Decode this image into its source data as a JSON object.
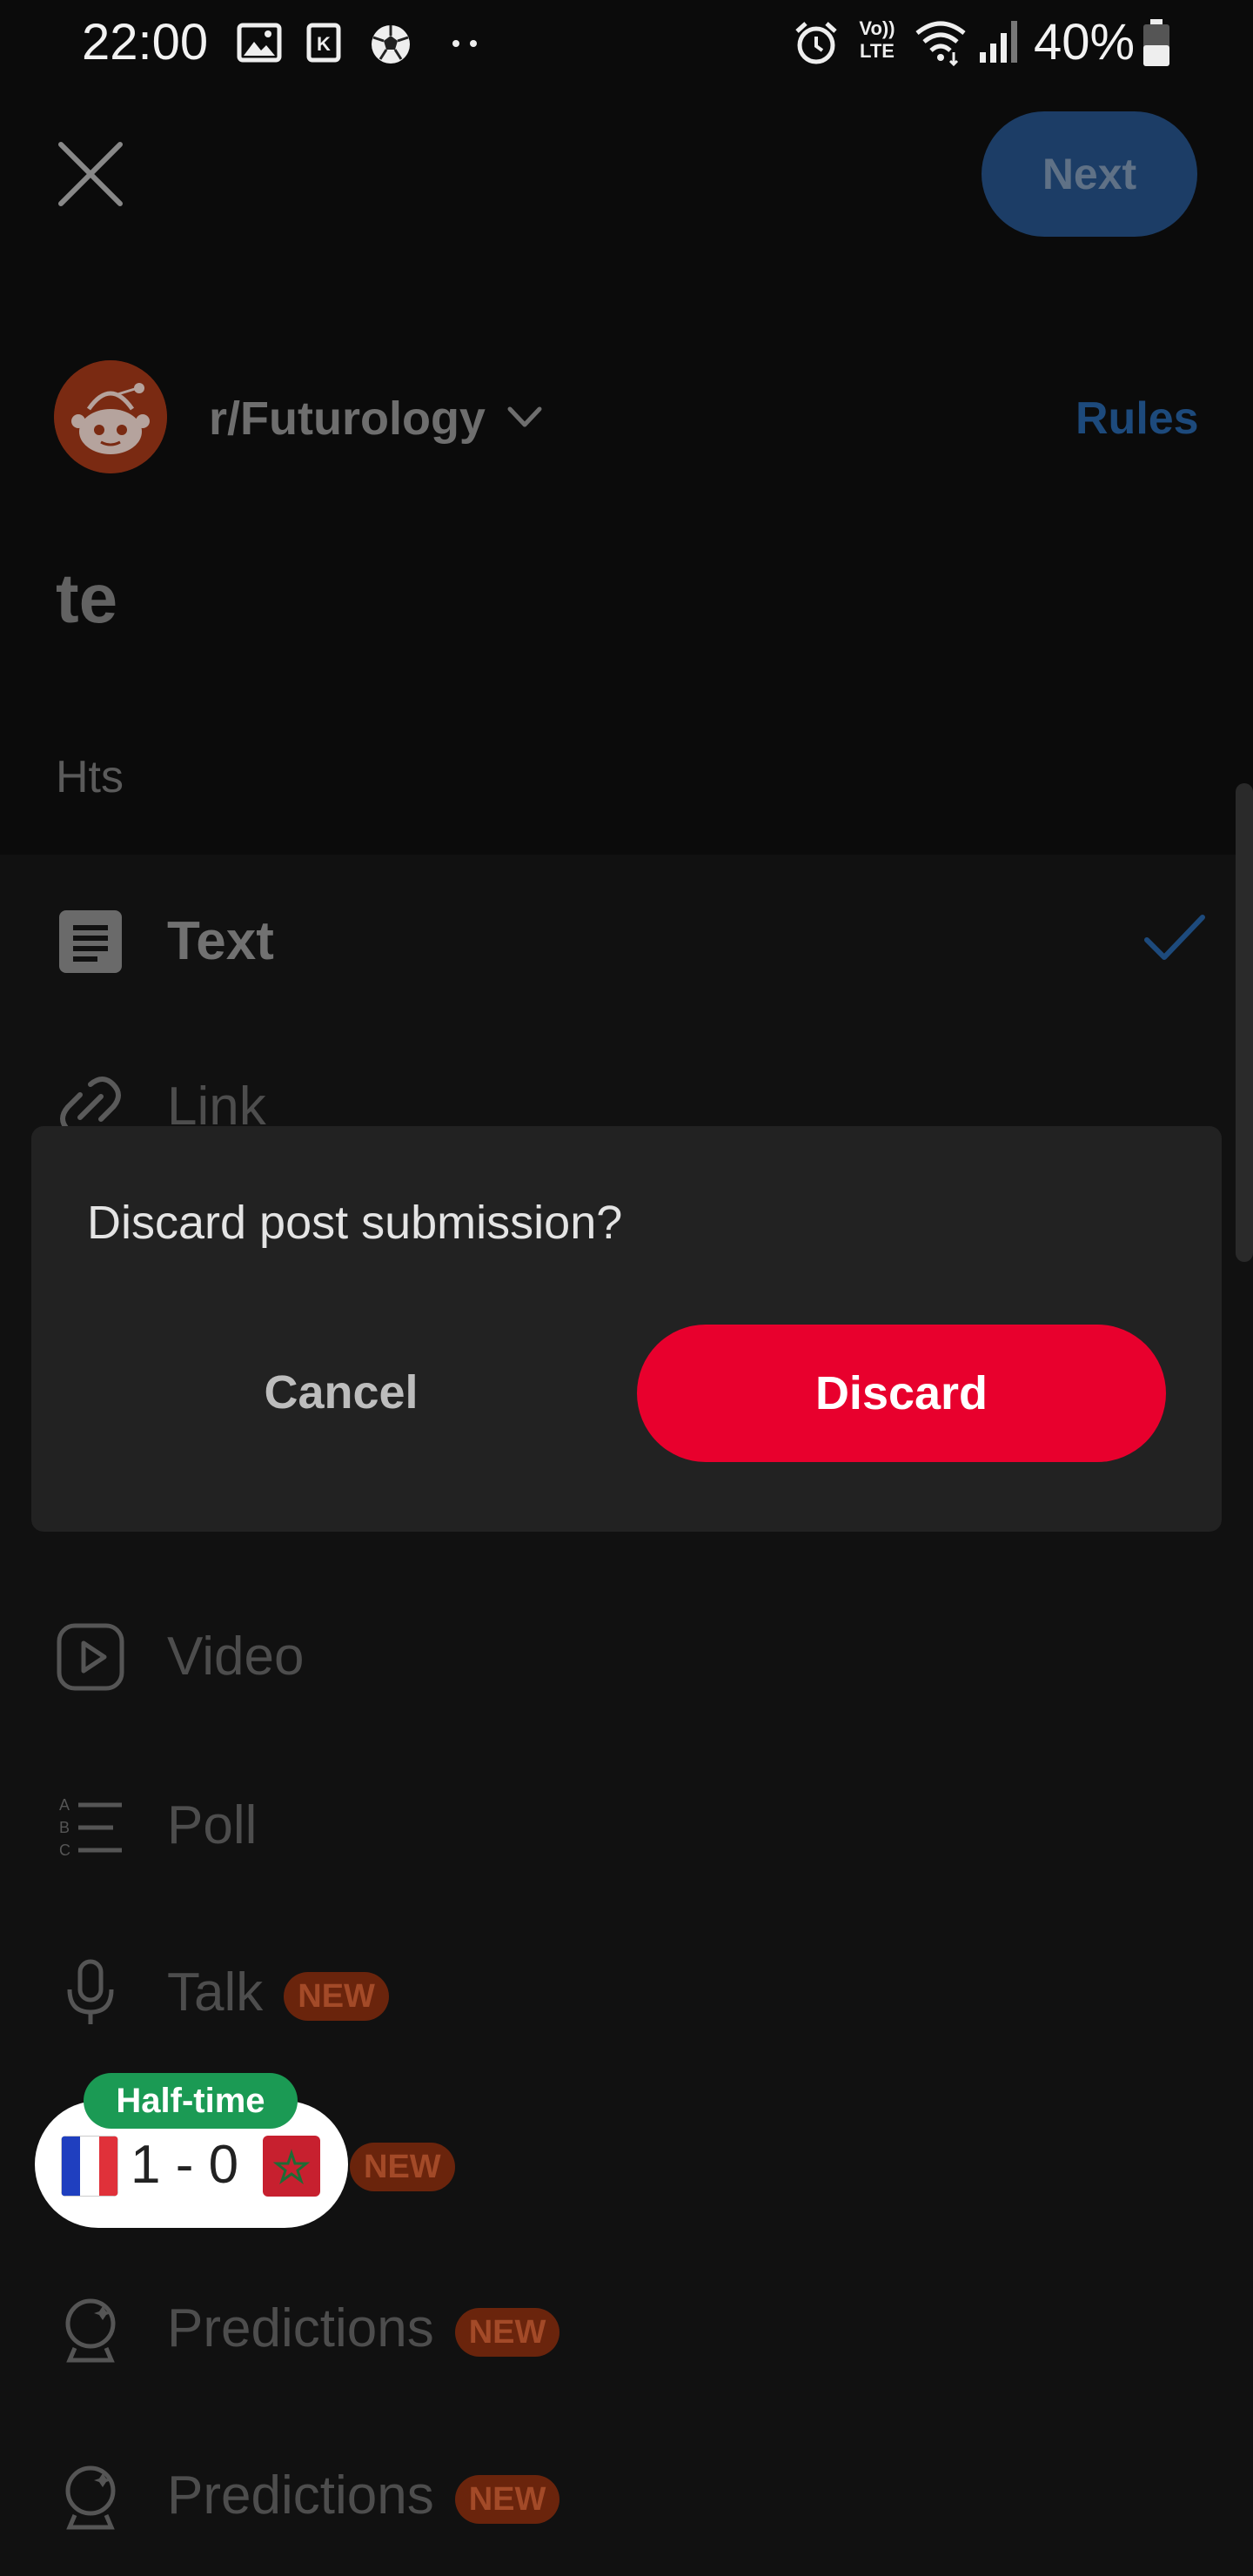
{
  "status_bar": {
    "time": "22:00",
    "battery": "40%",
    "icons": [
      "image-icon",
      "k-app-icon",
      "soccer-ball-icon",
      "more-dots-icon",
      "alarm-icon",
      "volte-icon",
      "wifi-icon",
      "signal-icon",
      "battery-icon"
    ],
    "volte_top": "Vo))",
    "volte_bottom": "LTE"
  },
  "header": {
    "close_icon": "close-icon",
    "next_label": "Next"
  },
  "community": {
    "name": "r/Futurology",
    "rules_label": "Rules",
    "avatar_icon": "snoo-avatar"
  },
  "post": {
    "title": "te",
    "body": "Hts"
  },
  "post_types": [
    {
      "label": "Text",
      "icon": "text-doc-icon",
      "selected": true
    },
    {
      "label": "Link",
      "icon": "link-icon"
    },
    {
      "label": "Video",
      "icon": "play-icon"
    },
    {
      "label": "Poll",
      "icon": "poll-icon"
    },
    {
      "label": "Talk",
      "icon": "mic-icon",
      "badge": "NEW"
    },
    {
      "label": "",
      "icon": "",
      "badge": "NEW"
    },
    {
      "label": "Predictions",
      "icon": "crystal-ball-icon",
      "badge": "NEW"
    },
    {
      "label": "Predictions",
      "icon": "crystal-ball-icon",
      "badge": "NEW"
    }
  ],
  "dialog": {
    "message": "Discard post submission?",
    "cancel_label": "Cancel",
    "discard_label": "Discard"
  },
  "score_widget": {
    "status": "Half-time",
    "score": "1  -  0",
    "home_flag": "france-flag",
    "away_flag": "morocco-flag"
  },
  "colors": {
    "background": "#0b0b0b",
    "dialog": "#222222",
    "discard": "#e8002d",
    "accent_blue": "#1c3d66",
    "new_badge": "#6a240c",
    "score_badge": "#1b9a54"
  }
}
